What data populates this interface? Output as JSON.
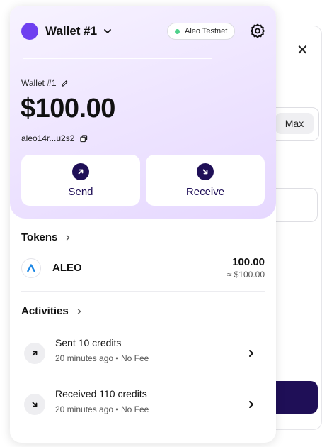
{
  "background_panel": {
    "close_icon": "close-icon",
    "max_label": "Max"
  },
  "header": {
    "wallet_name": "Wallet #1",
    "network": "Aleo Testnet",
    "network_status_color": "#4fd18b",
    "wallet_color": "#6e3ff0"
  },
  "account": {
    "label": "Wallet #1",
    "balance": "$100.00",
    "address": "aleo14r...u2s2"
  },
  "actions": {
    "send_label": "Send",
    "receive_label": "Receive"
  },
  "tokens": {
    "title": "Tokens",
    "items": [
      {
        "symbol": "ALEO",
        "amount": "100.00",
        "usd": "≈ $100.00"
      }
    ]
  },
  "activities": {
    "title": "Activities",
    "items": [
      {
        "title": "Sent 10 credits",
        "time": "20 minutes ago",
        "fee": "No Fee",
        "direction": "out"
      },
      {
        "title": "Received 110 credits",
        "time": "20 minutes ago",
        "fee": "No Fee",
        "direction": "in"
      }
    ]
  },
  "colors": {
    "accent_dark": "#1f0f57",
    "accent_purple": "#6e3ff0"
  }
}
